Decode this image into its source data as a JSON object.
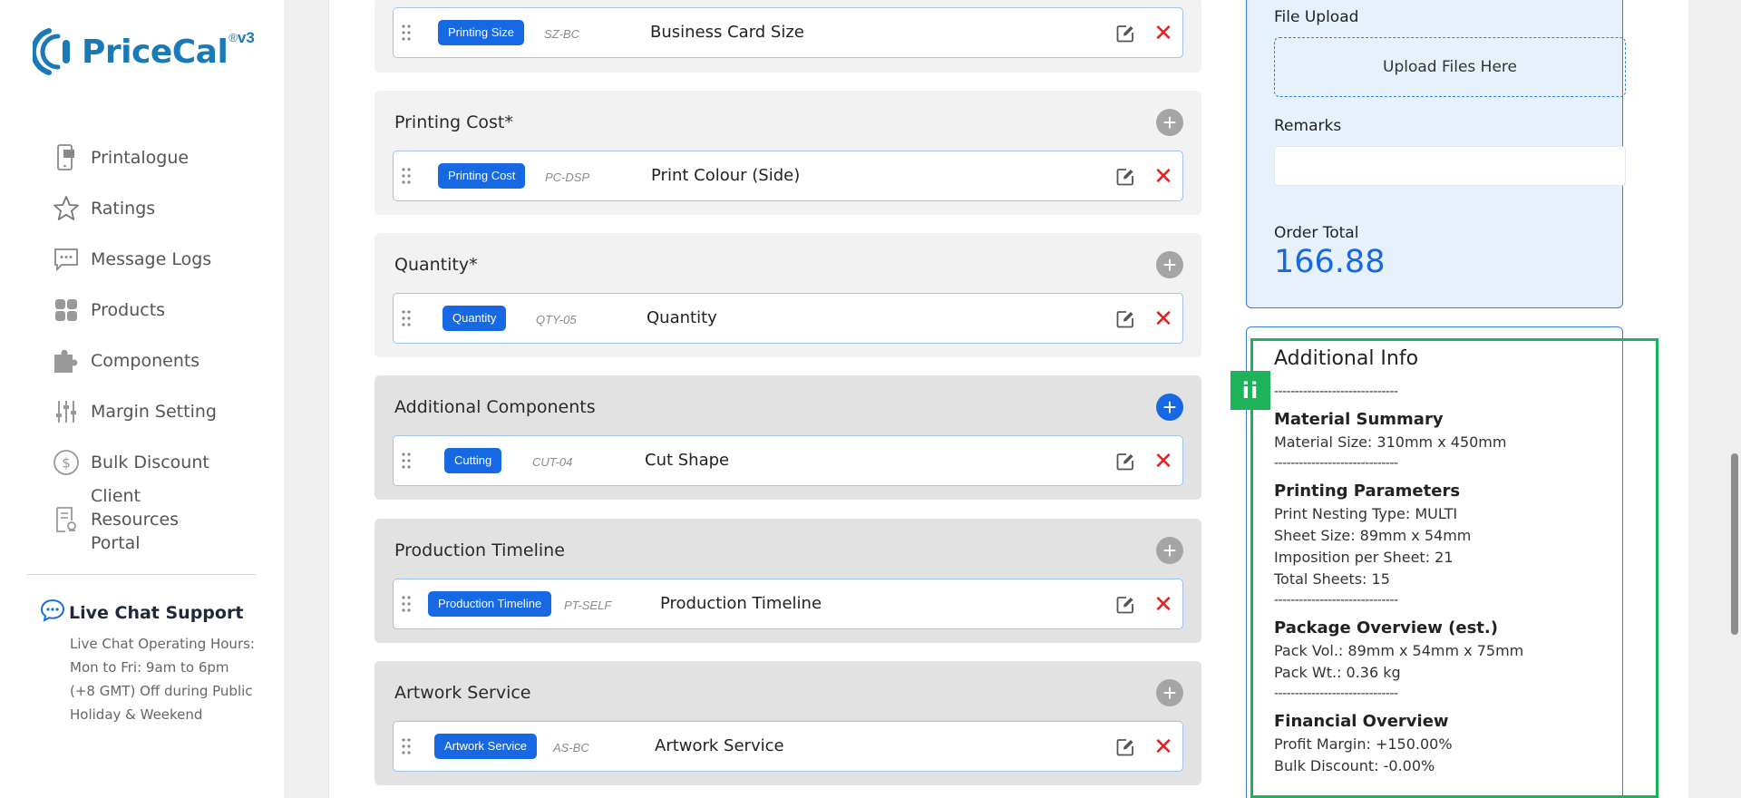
{
  "app": {
    "logo_text": "PriceCal",
    "logo_sup": "®",
    "logo_version": "v3"
  },
  "sidebar": {
    "items": [
      {
        "label": "Printalogue",
        "icon": "phone-catalog-icon"
      },
      {
        "label": "Ratings",
        "icon": "star-icon"
      },
      {
        "label": "Message Logs",
        "icon": "message-icon"
      },
      {
        "label": "Products",
        "icon": "grid-icon"
      },
      {
        "label": "Components",
        "icon": "puzzle-icon"
      },
      {
        "label": "Margin Setting",
        "icon": "sliders-icon"
      },
      {
        "label": "Bulk Discount",
        "icon": "dollar-circle-icon"
      },
      {
        "label": "Client Resources Portal",
        "icon": "document-icon"
      }
    ],
    "chat": {
      "title": "Live Chat Support",
      "hours": "Live Chat Operating Hours: Mon to Fri: 9am to 6pm (+8 GMT) Off during Public Holiday & Weekend"
    }
  },
  "sections": [
    {
      "title": "",
      "rows": [
        {
          "tag": "Printing Size",
          "code": "SZ-BC",
          "name": "Business Card Size"
        }
      ]
    },
    {
      "title": "Printing Cost*",
      "rows": [
        {
          "tag": "Printing Cost",
          "code": "PC-DSP",
          "name": "Print Colour (Side)"
        }
      ]
    },
    {
      "title": "Quantity*",
      "rows": [
        {
          "tag": "Quantity",
          "code": "QTY-05",
          "name": "Quantity"
        }
      ]
    },
    {
      "title": "Additional Components",
      "rows": [
        {
          "tag": "Cutting",
          "code": "CUT-04",
          "name": "Cut Shape"
        }
      ]
    },
    {
      "title": "Production Timeline",
      "rows": [
        {
          "tag": "Production Timeline",
          "code": "PT-SELF",
          "name": "Production Timeline"
        }
      ]
    },
    {
      "title": "Artwork Service",
      "rows": [
        {
          "tag": "Artwork Service",
          "code": "AS-BC",
          "name": "Artwork Service"
        }
      ]
    }
  ],
  "order": {
    "file_upload_label": "File Upload",
    "upload_text": "Upload Files Here",
    "remarks_label": "Remarks",
    "remarks_value": "",
    "total_label": "Order Total",
    "total_value": "166.88"
  },
  "info": {
    "badge": "ii",
    "title": "Additional Info",
    "separator": "------------------------------",
    "material": {
      "heading": "Material Summary",
      "lines": [
        "Material Size: 310mm x 450mm"
      ]
    },
    "printing": {
      "heading": "Printing Parameters",
      "lines": [
        "Print Nesting Type: MULTI",
        "Sheet Size: 89mm x 54mm",
        "Imposition per Sheet: 21",
        "Total Sheets: 15"
      ]
    },
    "package": {
      "heading": "Package Overview (est.)",
      "lines": [
        "Pack Vol.: 89mm x 54mm x 75mm",
        "Pack Wt.: 0.36 kg"
      ]
    },
    "financial": {
      "heading": "Financial Overview",
      "lines": [
        "Profit Margin: +150.00%",
        "Bulk Discount: -0.00%"
      ]
    }
  },
  "colors": {
    "accent": "#1668e3",
    "danger": "#e52020",
    "highlight": "#1db35b",
    "brand": "#1a7ab8"
  }
}
